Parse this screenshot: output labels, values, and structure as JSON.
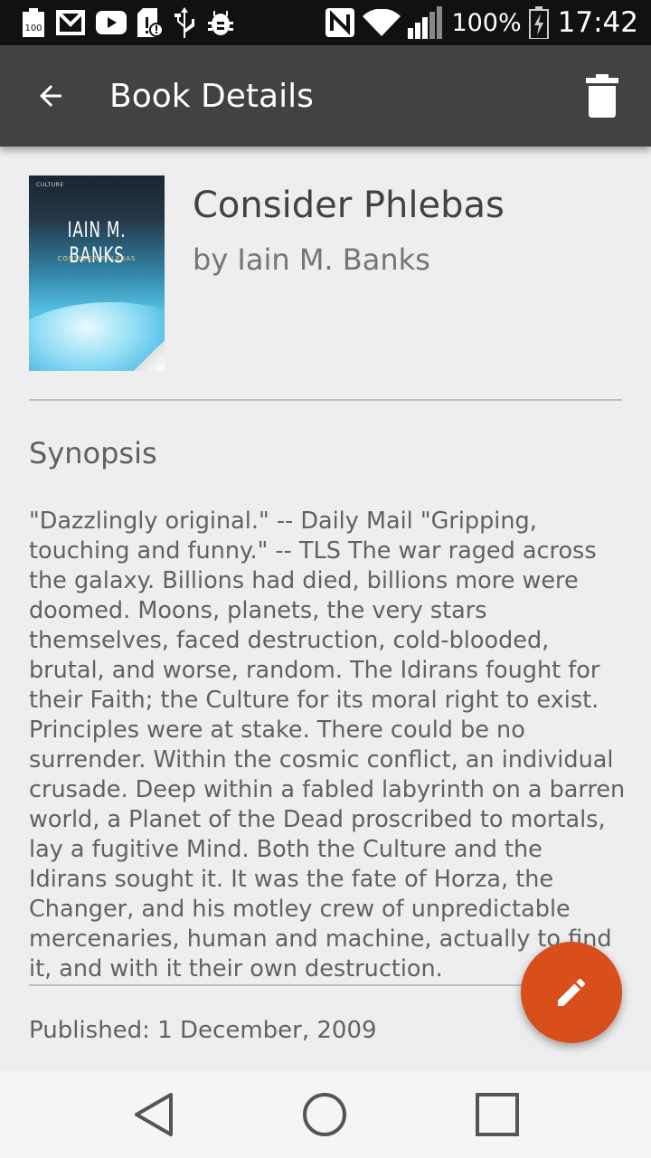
{
  "status_bar": {
    "battery_percent": "100%",
    "time": "17:42",
    "notification_icons": [
      "battery-100-icon",
      "gmail-icon",
      "youtube-icon",
      "sd-card-alert-icon",
      "usb-icon",
      "debug-icon"
    ],
    "system_icons": [
      "nfc-icon",
      "wifi-icon",
      "signal-icon",
      "battery-charging-icon"
    ],
    "small_battery_label": "100"
  },
  "app_bar": {
    "title": "Book Details",
    "back_icon": "arrow-back-icon",
    "delete_icon": "trash-icon",
    "background": "#424242"
  },
  "book": {
    "title": "Consider Phlebas",
    "author_line": "by Iain M. Banks",
    "cover": {
      "series_text": "CULTURE",
      "author_text": "IAIN M. BANKS",
      "title_text": "CONSIDER PHLEBAS"
    },
    "synopsis_heading": "Synopsis",
    "synopsis": "\"Dazzlingly original.\" -- Daily Mail \"Gripping, touching and funny.\" -- TLS The war raged across the galaxy. Billions had died, billions more were doomed. Moons, planets, the very stars themselves, faced destruction, cold-blooded, brutal, and worse, random. The Idirans fought for their Faith; the Culture for its moral right to exist. Principles were at stake. There could be no surrender. Within the cosmic conflict, an individual crusade. Deep within a fabled labyrinth on a barren world, a Planet of the Dead proscribed to mortals, lay a fugitive Mind. Both the Culture and the Idirans sought it. It was the fate of Horza, the Changer, and his motley crew of unpredictable mercenaries, human and machine, actually to find it, and with it their own destruction.",
    "published": "Published: 1 December, 2009"
  },
  "fab": {
    "icon": "pencil-edit-icon",
    "color": "#d84f1c"
  },
  "nav_bar": {
    "buttons": [
      "back-triangle-icon",
      "home-circle-icon",
      "recents-square-icon"
    ]
  }
}
